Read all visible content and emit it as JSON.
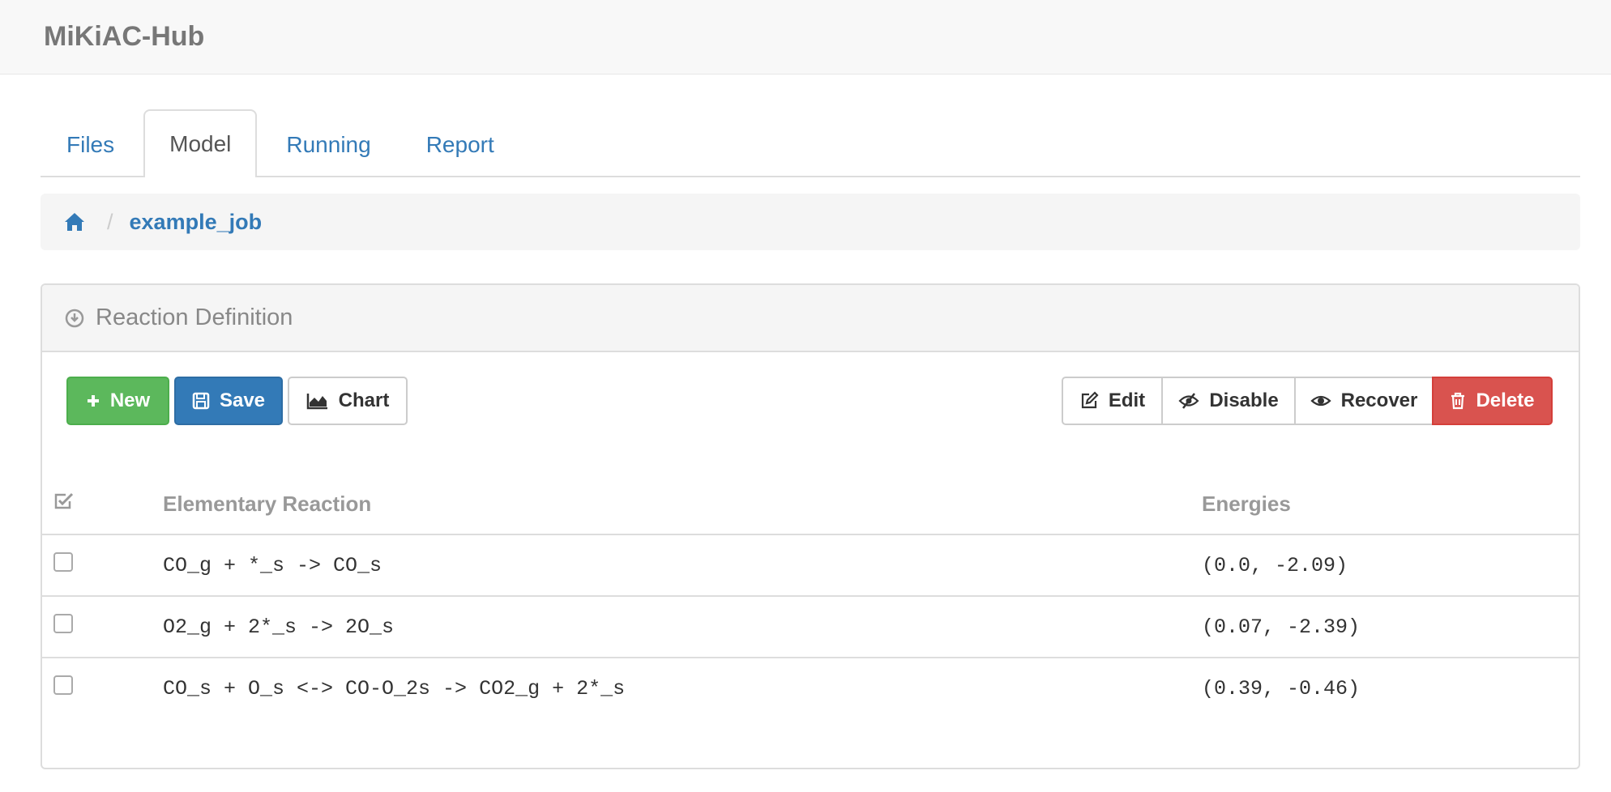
{
  "app": {
    "brand": "MiKiAC-Hub"
  },
  "tabs": [
    {
      "label": "Files"
    },
    {
      "label": "Model",
      "active": true
    },
    {
      "label": "Running"
    },
    {
      "label": "Report"
    }
  ],
  "breadcrumb": {
    "home_icon": "home-icon",
    "current": "example_job"
  },
  "panel": {
    "title": "Reaction Definition",
    "title_icon": "circle-arrow-down-icon"
  },
  "toolbar": {
    "new_label": "New",
    "save_label": "Save",
    "chart_label": "Chart",
    "edit_label": "Edit",
    "disable_label": "Disable",
    "recover_label": "Recover",
    "delete_label": "Delete"
  },
  "table": {
    "headers": {
      "select_icon": "check-square-icon",
      "reaction": "Elementary Reaction",
      "energies": "Energies"
    },
    "rows": [
      {
        "reaction": "CO_g + *_s -> CO_s",
        "energies": "(0.0, -2.09)",
        "checked": false
      },
      {
        "reaction": "O2_g + 2*_s -> 2O_s",
        "energies": "(0.07, -2.39)",
        "checked": false
      },
      {
        "reaction": "CO_s + O_s <-> CO-O_2s -> CO2_g + 2*_s",
        "energies": "(0.39, -0.46)",
        "checked": false
      }
    ]
  },
  "colors": {
    "link": "#337ab7",
    "success": "#5cb85c",
    "primary": "#337ab7",
    "danger": "#d9534f"
  }
}
